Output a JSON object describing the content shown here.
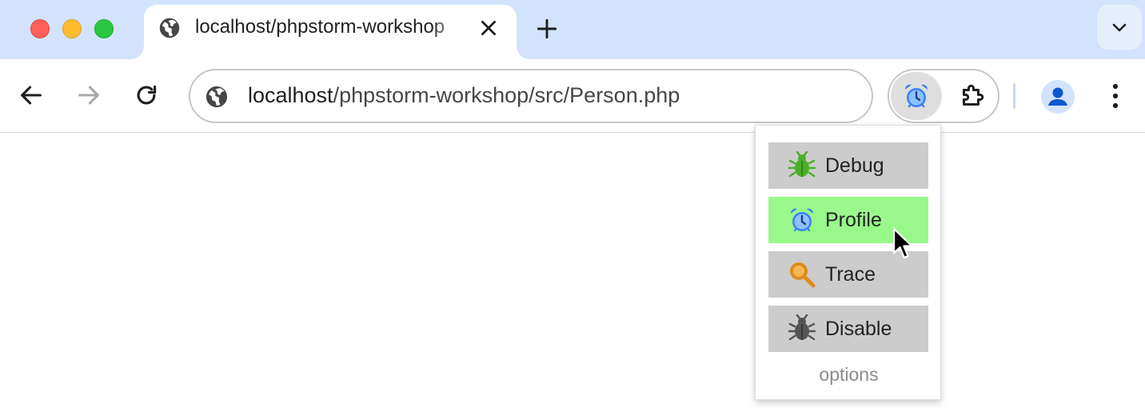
{
  "window": {
    "traffic_lights": [
      "close",
      "minimize",
      "zoom"
    ]
  },
  "tab": {
    "title": "localhost/phpstorm-workshop",
    "icon": "globe-icon",
    "close_icon": "close-icon"
  },
  "tabstrip": {
    "new_tab_icon": "plus-icon",
    "tab_search_icon": "chevron-down-icon"
  },
  "toolbar": {
    "back_icon": "arrow-left-icon",
    "forward_icon": "arrow-right-icon",
    "reload_icon": "reload-icon",
    "forward_enabled": false
  },
  "omnibox": {
    "host": "localhost",
    "path": "/phpstorm-workshop/src/Person.php",
    "site_icon": "globe-icon"
  },
  "extensions": {
    "active_extension_icon": "alarm-clock-icon",
    "extensions_menu_icon": "puzzle-icon",
    "profile_icon": "person-icon",
    "menu_icon": "kebab-menu-icon"
  },
  "popup": {
    "items": [
      {
        "label": "Debug",
        "icon": "bug-icon",
        "color": "#4caf2a",
        "active": false
      },
      {
        "label": "Profile",
        "icon": "alarm-clock-icon",
        "color": "#3b82f6",
        "active": true
      },
      {
        "label": "Trace",
        "icon": "magnifier-icon",
        "color": "#e08a1e",
        "active": false
      },
      {
        "label": "Disable",
        "icon": "bug-icon",
        "color": "#555555",
        "active": false
      }
    ],
    "options_label": "options",
    "active_color": "#98f98a",
    "item_color": "#cccccc"
  }
}
